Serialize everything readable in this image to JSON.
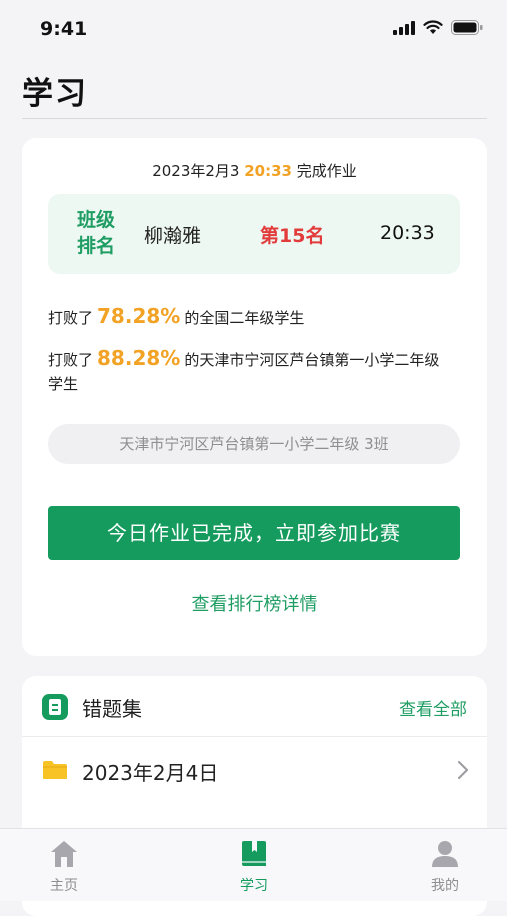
{
  "status_bar": {
    "time": "9:41"
  },
  "header": {
    "title": "学习"
  },
  "homework_card": {
    "summary_prefix": "2023年2月3",
    "summary_time": "20:33",
    "summary_suffix": "完成作业",
    "rank": {
      "label_line1": "班级",
      "label_line2": "排名",
      "student_name": "柳瀚雅",
      "position": "第15名",
      "time": "20:33"
    },
    "beat_national": {
      "prefix": "打败了",
      "percent": "78.28%",
      "suffix": "的全国二年级学生"
    },
    "beat_school": {
      "prefix": "打败了",
      "percent": "88.28%",
      "suffix": "的天津市宁河区芦台镇第一小学二年级学生"
    },
    "class_name": "天津市宁河区芦台镇第一小学二年级 3班",
    "join_button_label": "今日作业已完成，立即参加比赛",
    "leaderboard_link": "查看排行榜详情"
  },
  "wrong_questions": {
    "title": "错题集",
    "view_all_label": "查看全部",
    "items": [
      {
        "date": "2023年2月4日"
      }
    ]
  },
  "tab_bar": {
    "tabs": [
      {
        "label": "主页",
        "icon": "home-icon",
        "active": false
      },
      {
        "label": "学习",
        "icon": "book-icon",
        "active": true
      },
      {
        "label": "我的",
        "icon": "person-icon",
        "active": false
      }
    ]
  },
  "colors": {
    "accent": "#149b5d",
    "highlight": "#f2a224",
    "rank": "#e23b3b"
  }
}
